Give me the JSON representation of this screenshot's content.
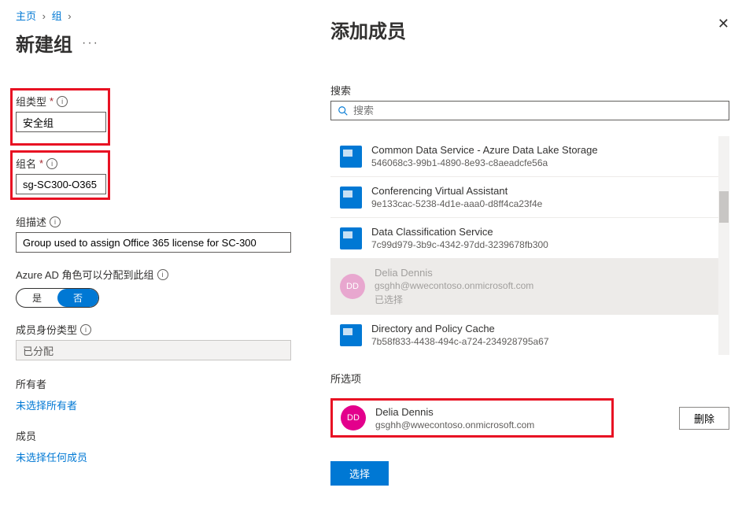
{
  "breadcrumb": {
    "home": "主页",
    "group": "组"
  },
  "page_title": "新建组",
  "fields": {
    "group_type_label": "组类型",
    "group_type_value": "安全组",
    "group_name_label": "组名",
    "group_name_value": "sg-SC300-O365",
    "group_desc_label": "组描述",
    "group_desc_value": "Group used to assign Office 365 license for SC-300",
    "azure_ad_label": "Azure AD 角色可以分配到此组",
    "toggle_yes": "是",
    "toggle_no": "否",
    "member_type_label": "成员身份类型",
    "member_type_value": "已分配",
    "owners_label": "所有者",
    "owners_link": "未选择所有者",
    "members_label": "成员",
    "members_link": "未选择任何成员"
  },
  "panel": {
    "title": "添加成员",
    "search_label": "搜索",
    "search_placeholder": "搜索",
    "selected_label": "所选项",
    "delete_btn": "删除",
    "select_btn": "选择"
  },
  "results": [
    {
      "name": "Common Data Service - Azure Data Lake Storage",
      "sub": "546068c3-99b1-4890-8e93-c8aeadcfe56a",
      "type": "app"
    },
    {
      "name": "Conferencing Virtual Assistant",
      "sub": "9e133cac-5238-4d1e-aaa0-d8ff4ca23f4e",
      "type": "app"
    },
    {
      "name": "Data Classification Service",
      "sub": "7c99d979-3b9c-4342-97dd-3239678fb300",
      "type": "app"
    },
    {
      "name": "Delia Dennis",
      "sub": "gsghh@wwecontoso.onmicrosoft.com",
      "type": "user",
      "initials": "DD",
      "status": "已选择",
      "selected": true
    },
    {
      "name": "Directory and Policy Cache",
      "sub": "7b58f833-4438-494c-a724-234928795a67",
      "type": "app"
    }
  ],
  "selected_item": {
    "name": "Delia Dennis",
    "sub": "gsghh@wwecontoso.onmicrosoft.com",
    "initials": "DD"
  }
}
